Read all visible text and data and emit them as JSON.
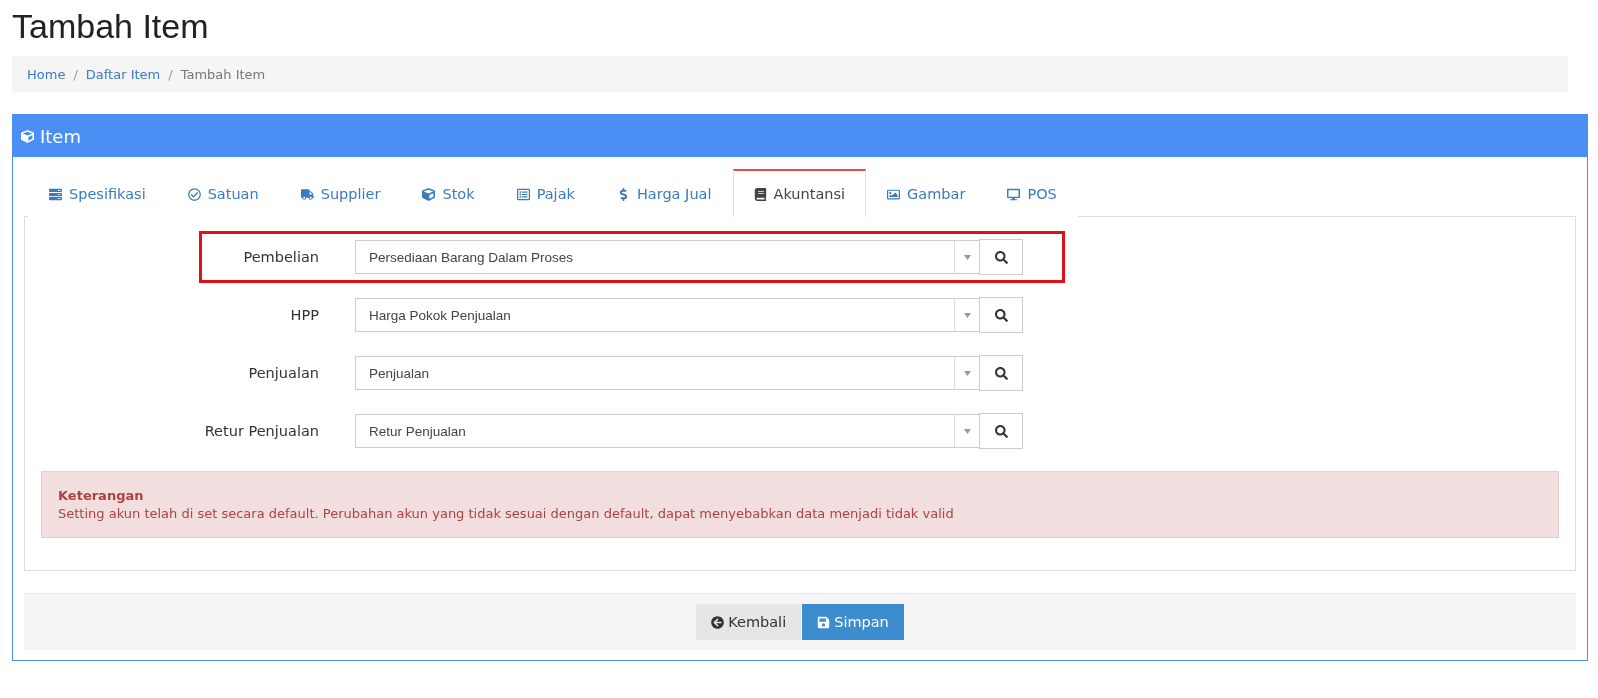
{
  "page_title": "Tambah Item",
  "breadcrumb_separator": "/",
  "breadcrumb": [
    {
      "label": "Home",
      "current": false
    },
    {
      "label": "Daftar Item",
      "current": false
    },
    {
      "label": "Tambah Item",
      "current": true
    }
  ],
  "panel": {
    "title": "Item"
  },
  "tabs": [
    {
      "label": "Spesifikasi",
      "selected": false
    },
    {
      "label": "Satuan",
      "selected": false
    },
    {
      "label": "Supplier",
      "selected": false
    },
    {
      "label": "Stok",
      "selected": false
    },
    {
      "label": "Pajak",
      "selected": false
    },
    {
      "label": "Harga Jual",
      "selected": false
    },
    {
      "label": "Akuntansi",
      "selected": true
    },
    {
      "label": "Gambar",
      "selected": false
    },
    {
      "label": "POS",
      "selected": false
    }
  ],
  "fields": [
    {
      "label": "Pembelian",
      "value": "Persediaan Barang Dalam Proses",
      "highlighted": true
    },
    {
      "label": "HPP",
      "value": "Harga Pokok Penjualan",
      "highlighted": false
    },
    {
      "label": "Penjualan",
      "value": "Penjualan",
      "highlighted": false
    },
    {
      "label": "Retur Penjualan",
      "value": "Retur Penjualan",
      "highlighted": false
    }
  ],
  "alert": {
    "title": "Keterangan",
    "text": "Setting akun telah di set secara default. Perubahan akun yang tidak sesuai dengan default, dapat menyebabkan data menjadi tidak valid"
  },
  "buttons": [
    {
      "label": "Kembali",
      "kind": "back"
    },
    {
      "label": "Simpan",
      "kind": "save"
    }
  ]
}
